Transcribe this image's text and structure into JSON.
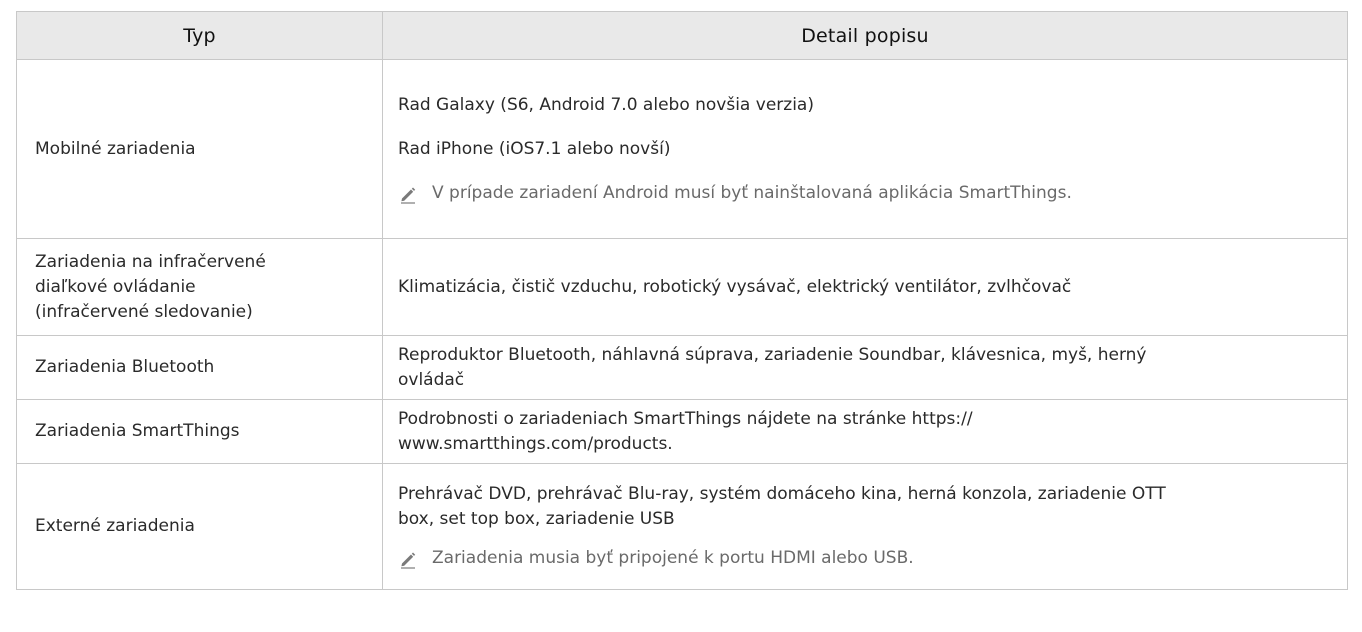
{
  "header": {
    "col_type": "Typ",
    "col_detail": "Detail popisu"
  },
  "rows": [
    {
      "type": "Mobilné zariadenia",
      "lines": [
        "Rad Galaxy (S6, Android 7.0 alebo novšia verzia)",
        "Rad iPhone (iOS7.1 alebo novší)"
      ],
      "note": "V prípade zariadení Android musí byť nainštalovaná aplikácia SmartThings."
    },
    {
      "type_lines": [
        "Zariadenia na infračervené",
        "diaľkové ovládanie",
        "(infračervené sledovanie)"
      ],
      "detail": "Klimatizácia, čistič vzduchu, robotický vysávač, elektrický ventilátor, zvlhčovač"
    },
    {
      "type": "Zariadenia Bluetooth",
      "detail_lines": [
        "Reproduktor Bluetooth, náhlavná súprava, zariadenie Soundbar, klávesnica, myš, herný",
        "ovládač"
      ]
    },
    {
      "type": "Zariadenia SmartThings",
      "detail_lines": [
        "Podrobnosti o zariadeniach SmartThings nájdete na stránke https://",
        "www.smartthings.com/products."
      ]
    },
    {
      "type": "Externé zariadenia",
      "detail_lines": [
        "Prehrávač DVD, prehrávač Blu-ray, systém domáceho kina, herná konzola, zariadenie OTT",
        "box, set top box, zariadenie USB"
      ],
      "note": "Zariadenia musia byť pripojené k portu HDMI alebo USB."
    }
  ],
  "icons": {
    "note": "pencil-note-icon"
  },
  "colors": {
    "header_bg": "#e9e9e9",
    "border": "#c8c8c8",
    "note_text": "#6a6a6a"
  }
}
